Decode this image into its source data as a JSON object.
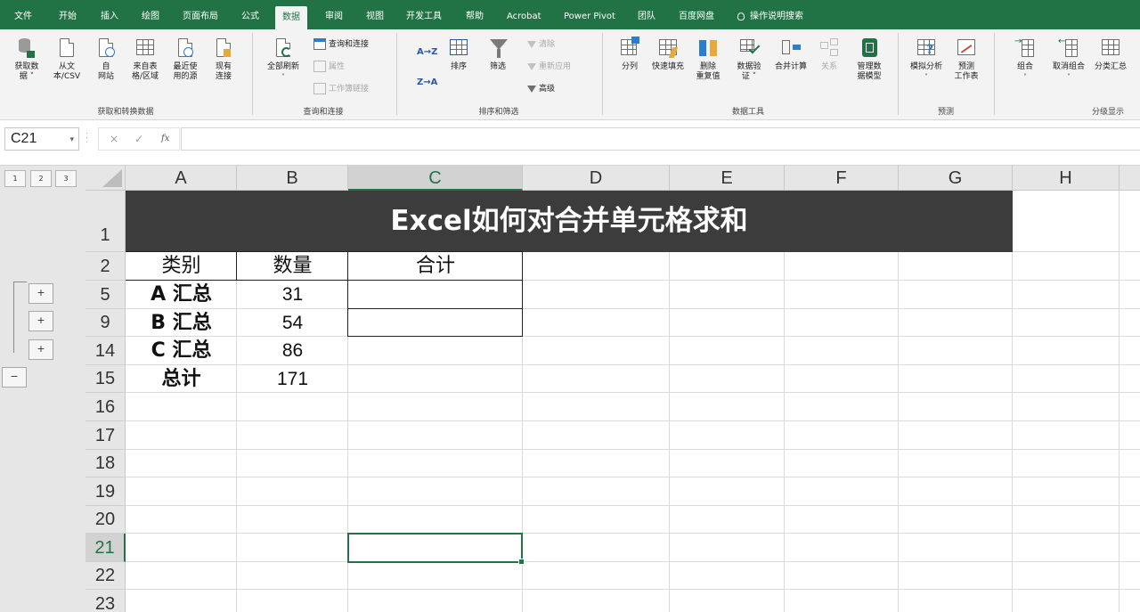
{
  "menu": {
    "tabs": [
      "文件",
      "开始",
      "插入",
      "绘图",
      "页面布局",
      "公式",
      "数据",
      "审阅",
      "视图",
      "开发工具",
      "帮助",
      "Acrobat",
      "Power Pivot",
      "团队",
      "百度网盘",
      "操作说明搜索"
    ],
    "active_tab": "数据",
    "search_icon": "lightbulb-icon"
  },
  "ribbon": {
    "get_transform": {
      "group_label": "获取和转换数据",
      "get_data": [
        "获取数",
        "据 ˅"
      ],
      "from_csv": [
        "从文",
        "本/CSV"
      ],
      "from_web": [
        "自",
        "网站"
      ],
      "from_table": [
        "来自表",
        "格/区域"
      ],
      "recent_sources": [
        "最近使",
        "用的源"
      ],
      "existing_conn": [
        "现有",
        "连接"
      ]
    },
    "queries": {
      "group_label": "查询和连接",
      "refresh_all": [
        "全部刷新",
        "˅"
      ],
      "queries_conn": "查询和连接",
      "properties": "属性",
      "edit_links": "工作簿链接"
    },
    "sort_filter": {
      "group_label": "排序和筛选",
      "sort_az": "A→Z",
      "sort_za": "Z→A",
      "sort": "排序",
      "filter": "筛选",
      "clear": "清除",
      "reapply": "重新应用",
      "advanced": "高级"
    },
    "data_tools": {
      "group_label": "数据工具",
      "text_to_columns": "分列",
      "flash_fill": "快速填充",
      "remove_dup": [
        "删除",
        "重复值"
      ],
      "validation": [
        "数据验",
        "证 ˅"
      ],
      "consolidate": "合并计算",
      "relationships": "关系",
      "data_model": [
        "管理数",
        "据模型"
      ]
    },
    "forecast": {
      "group_label": "预测",
      "what_if": [
        "模拟分析",
        "˅"
      ],
      "forecast_sheet": [
        "预测",
        "工作表"
      ]
    },
    "outline": {
      "group_label": "分级显示",
      "group": [
        "组合",
        "˅"
      ],
      "ungroup": [
        "取消组合",
        "˅"
      ],
      "subtotal": "分类汇总"
    }
  },
  "formula_bar": {
    "name_box": "C21",
    "cancel": "×",
    "confirm": "✓",
    "fx": "fx",
    "formula": ""
  },
  "outline": {
    "levels": [
      "1",
      "2",
      "3"
    ],
    "expand": "+",
    "collapse": "−"
  },
  "sheet": {
    "columns": [
      "A",
      "B",
      "C",
      "D",
      "E",
      "F",
      "G",
      "H"
    ],
    "rows": [
      "1",
      "2",
      "5",
      "9",
      "14",
      "15",
      "16",
      "17",
      "18",
      "19",
      "20",
      "21",
      "22",
      "23"
    ],
    "selected_column": "C",
    "selected_row": "21",
    "title": "Excel如何对合并单元格求和",
    "headers": [
      "类别",
      "数量",
      "合计"
    ],
    "data": [
      {
        "category": "A 汇总",
        "qty": "31"
      },
      {
        "category": "B 汇总",
        "qty": "54"
      },
      {
        "category": "C 汇总",
        "qty": "86"
      },
      {
        "category": "总计",
        "qty": "171"
      }
    ]
  },
  "colors": {
    "accent": "#217346",
    "title_band": "#3c3c3c"
  }
}
